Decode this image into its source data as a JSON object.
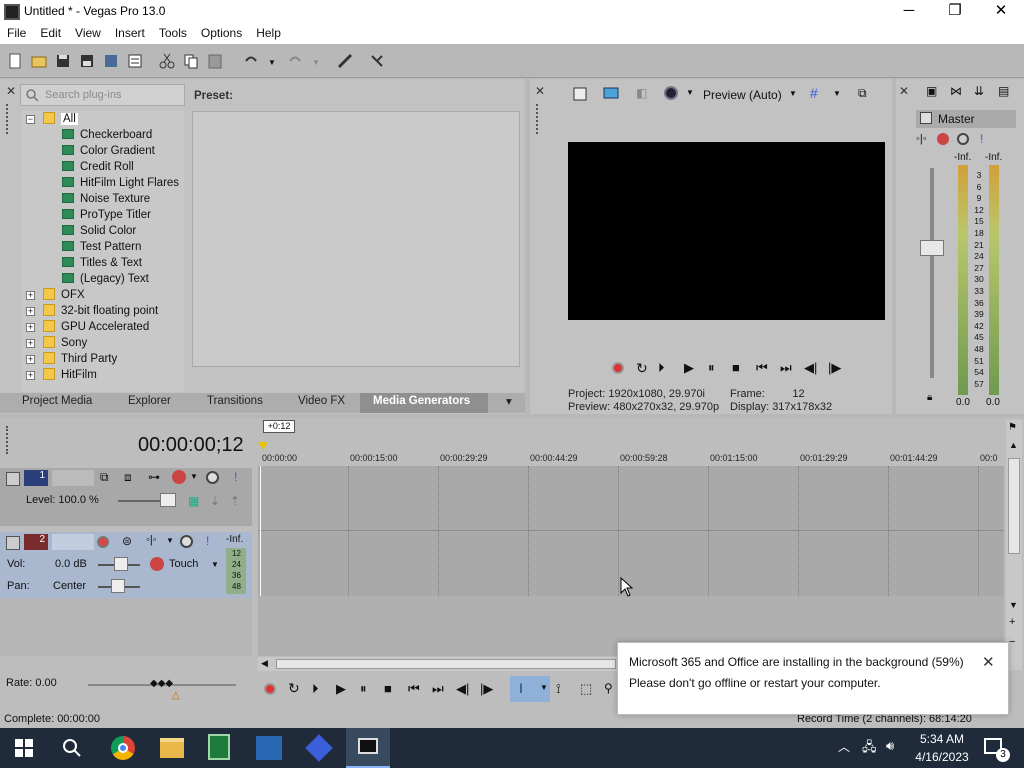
{
  "window": {
    "title": "Untitled * - Vegas Pro 13.0",
    "minimize": "─",
    "maximize": "❐",
    "close": "✕"
  },
  "menu": [
    "File",
    "Edit",
    "View",
    "Insert",
    "Tools",
    "Options",
    "Help"
  ],
  "plugin_panel": {
    "search_placeholder": "Search plug-ins",
    "preset_label": "Preset:",
    "tree": [
      {
        "label": "All",
        "type": "folder",
        "expanded": true,
        "selected": true
      },
      {
        "label": "Checkerboard",
        "type": "plugin"
      },
      {
        "label": "Color Gradient",
        "type": "plugin"
      },
      {
        "label": "Credit Roll",
        "type": "plugin"
      },
      {
        "label": "HitFilm Light Flares",
        "type": "plugin"
      },
      {
        "label": "Noise Texture",
        "type": "plugin"
      },
      {
        "label": "ProType Titler",
        "type": "plugin"
      },
      {
        "label": "Solid Color",
        "type": "plugin"
      },
      {
        "label": "Test Pattern",
        "type": "plugin"
      },
      {
        "label": "Titles & Text",
        "type": "plugin"
      },
      {
        "label": "(Legacy) Text",
        "type": "plugin"
      },
      {
        "label": "OFX",
        "type": "folder"
      },
      {
        "label": "32-bit floating point",
        "type": "folder"
      },
      {
        "label": "GPU Accelerated",
        "type": "folder"
      },
      {
        "label": "Sony",
        "type": "folder"
      },
      {
        "label": "Third Party",
        "type": "folder"
      },
      {
        "label": "HitFilm",
        "type": "folder"
      }
    ]
  },
  "tabs": [
    "Project Media",
    "Explorer",
    "Transitions",
    "Video FX",
    "Media Generators"
  ],
  "active_tab": "Media Generators",
  "preview": {
    "mode": "Preview (Auto)",
    "project_label": "Project:",
    "project_value": "1920x1080, 29.970i",
    "preview_label": "Preview:",
    "preview_value": "480x270x32, 29.970p",
    "frame_label": "Frame:",
    "frame_value": "12",
    "display_label": "Display:",
    "display_value": "317x178x32"
  },
  "master": {
    "label": "Master",
    "left_peak": "-Inf.",
    "right_peak": "-Inf.",
    "scale": [
      "3",
      "6",
      "9",
      "12",
      "15",
      "18",
      "21",
      "24",
      "27",
      "30",
      "33",
      "36",
      "39",
      "42",
      "45",
      "48",
      "51",
      "54",
      "57"
    ],
    "left_value": "0.0",
    "right_value": "0.0"
  },
  "timeline": {
    "timecode": "00:00:00;12",
    "cursor_flag": "+0:12",
    "ruler": [
      "00:00:00",
      "00:00:15:00",
      "00:00:29:29",
      "00:00:44:29",
      "00:00:59:28",
      "00:01:15:00",
      "00:01:29:29",
      "00:01:44:29",
      "00:0"
    ],
    "video_track": {
      "number": "1",
      "level_label": "Level: 100.0 %"
    },
    "audio_track": {
      "number": "2",
      "vol_label": "Vol:",
      "vol_value": "0.0 dB",
      "pan_label": "Pan:",
      "pan_value": "Center",
      "mode": "Touch",
      "peak": "-Inf.",
      "meter": [
        "12",
        "24",
        "36",
        "48"
      ]
    },
    "rate": "Rate: 0.00",
    "complete": "Complete: 00:00:00",
    "record_time": "Record Time (2 channels): 68:14:20"
  },
  "toast": {
    "line1": "Microsoft 365 and Office are installing in the background (59%)",
    "line2": "Please don't go offline or restart your computer.",
    "progress_percent": 59
  },
  "taskbar": {
    "time": "5:34 AM",
    "date": "4/16/2023",
    "notifications": "3"
  }
}
